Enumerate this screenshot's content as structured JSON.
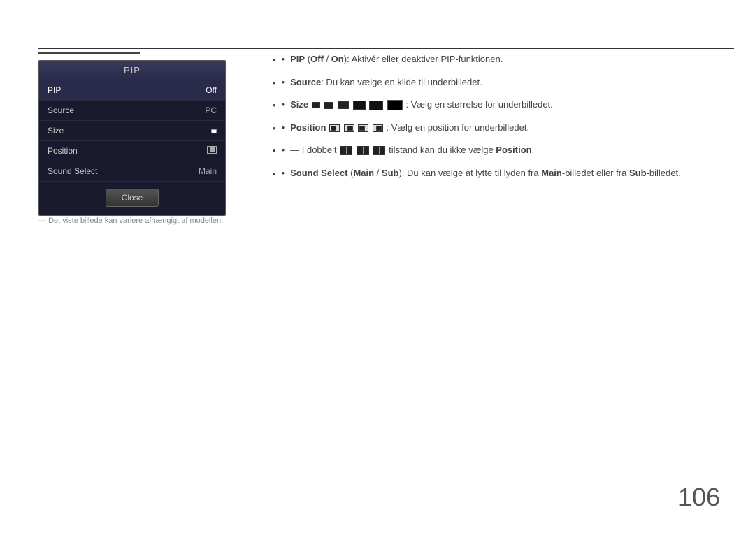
{
  "page": {
    "page_number": "106"
  },
  "top_line": {},
  "left_panel": {
    "pip_title": "PIP",
    "menu_items": [
      {
        "label": "PIP",
        "value": "Off",
        "active": true
      },
      {
        "label": "Source",
        "value": "PC",
        "active": false
      },
      {
        "label": "Size",
        "value": "",
        "active": false
      },
      {
        "label": "Position",
        "value": "",
        "active": false
      },
      {
        "label": "Sound Select",
        "value": "Main",
        "active": false
      }
    ],
    "close_button": "Close"
  },
  "footer_note": "― Det viste billede kan variere afhængigt af modellen.",
  "right_content": {
    "bullets": [
      {
        "id": "pip",
        "text_parts": [
          {
            "type": "bold",
            "text": "PIP"
          },
          {
            "type": "normal",
            "text": " ("
          },
          {
            "type": "bold",
            "text": "Off"
          },
          {
            "type": "normal",
            "text": " / "
          },
          {
            "type": "bold",
            "text": "On"
          },
          {
            "type": "normal",
            "text": "): Aktivér eller deaktiver PIP-funktionen."
          }
        ]
      },
      {
        "id": "source",
        "text_parts": [
          {
            "type": "bold",
            "text": "Source"
          },
          {
            "type": "normal",
            "text": ": Du kan vælge en kilde til underbilledet."
          }
        ]
      },
      {
        "id": "size",
        "text_parts": [
          {
            "type": "bold",
            "text": "Size"
          },
          {
            "type": "normal",
            "text": ": Vælg en størrelse for underbilledet."
          }
        ],
        "has_size_icons": true
      },
      {
        "id": "position",
        "text_parts": [
          {
            "type": "bold",
            "text": "Position"
          },
          {
            "type": "normal",
            "text": ": Vælg en position for underbilledet."
          }
        ],
        "has_pos_icons": true
      },
      {
        "id": "double",
        "text_parts": [
          {
            "type": "normal",
            "text": "― I dobbelt"
          },
          {
            "type": "normal",
            "text": " tilstand kan du ikke vælge "
          },
          {
            "type": "bold",
            "text": "Position"
          },
          {
            "type": "normal",
            "text": "."
          }
        ],
        "has_dbl_icons": true
      },
      {
        "id": "sound_select",
        "text_parts": [
          {
            "type": "bold",
            "text": "Sound Select"
          },
          {
            "type": "normal",
            "text": " ("
          },
          {
            "type": "bold",
            "text": "Main"
          },
          {
            "type": "normal",
            "text": " / "
          },
          {
            "type": "bold",
            "text": "Sub"
          },
          {
            "type": "normal",
            "text": "): Du kan vælge at lytte til lyden fra "
          },
          {
            "type": "bold",
            "text": "Main"
          },
          {
            "type": "normal",
            "text": "-billedet eller fra "
          },
          {
            "type": "bold",
            "text": "Sub"
          },
          {
            "type": "normal",
            "text": "-billedet."
          }
        ]
      }
    ]
  }
}
